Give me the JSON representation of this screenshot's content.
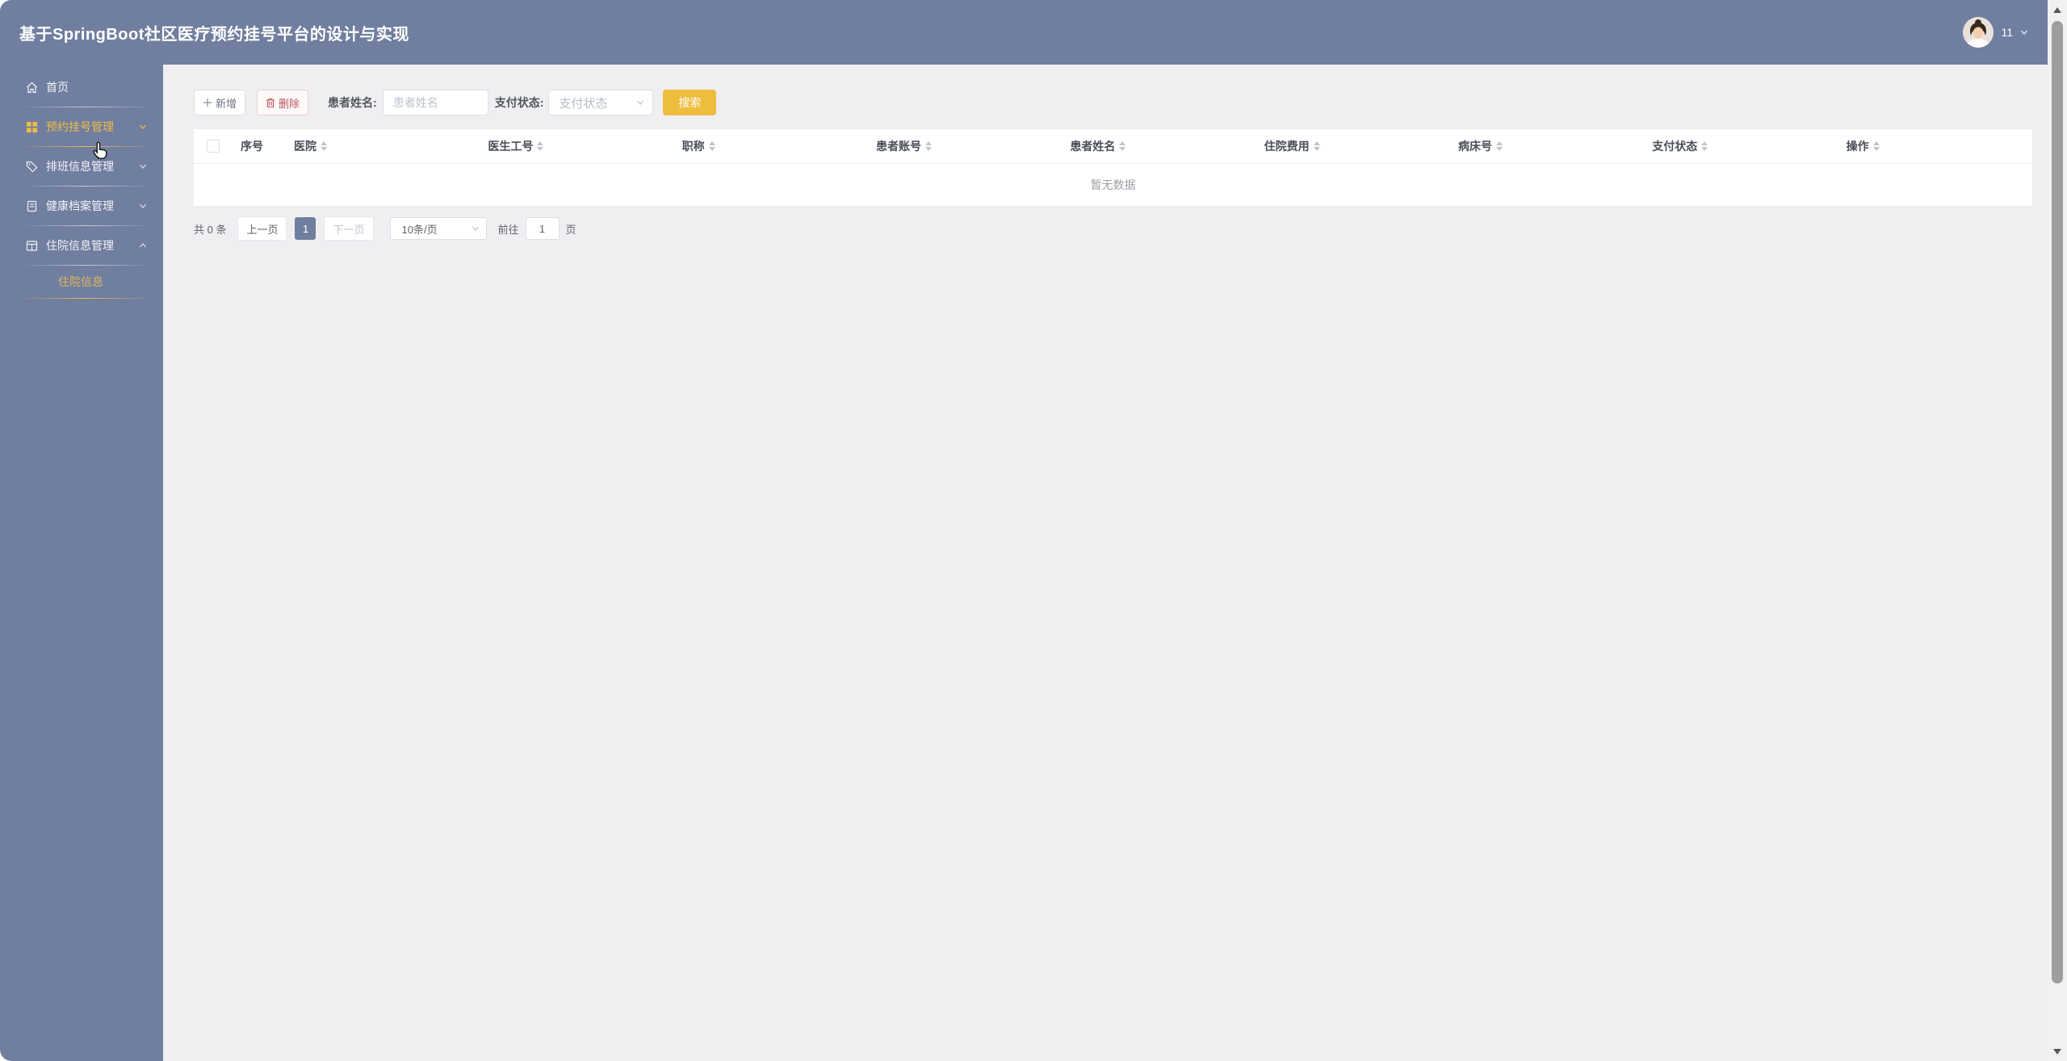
{
  "header": {
    "title": "基于SpringBoot社区医疗预约挂号平台的设计与实现",
    "username": "11"
  },
  "sidebar": {
    "items": [
      {
        "label": "首页",
        "icon": "home-icon",
        "state": "normal"
      },
      {
        "label": "预约挂号管理",
        "icon": "appointment-grid-icon",
        "state": "hovered",
        "chevron": "down"
      },
      {
        "label": "排班信息管理",
        "icon": "schedule-tag-icon",
        "state": "normal",
        "chevron": "down"
      },
      {
        "label": "健康档案管理",
        "icon": "health-record-icon",
        "state": "normal",
        "chevron": "down"
      },
      {
        "label": "住院信息管理",
        "icon": "hospitalization-table-icon",
        "state": "expanded",
        "chevron": "up"
      },
      {
        "label": "住院信息",
        "submenu": true,
        "state": "active"
      }
    ]
  },
  "toolbar": {
    "add_label": "新增",
    "delete_label": "删除",
    "patient_name_label": "患者姓名:",
    "patient_name_placeholder": "患者姓名",
    "pay_status_label": "支付状态:",
    "pay_status_placeholder": "支付状态",
    "search_label": "搜索"
  },
  "table": {
    "columns": [
      {
        "label": "序号",
        "sortable": false
      },
      {
        "label": "医院",
        "sortable": true
      },
      {
        "label": "医生工号",
        "sortable": true
      },
      {
        "label": "职称",
        "sortable": true
      },
      {
        "label": "患者账号",
        "sortable": true
      },
      {
        "label": "患者姓名",
        "sortable": true
      },
      {
        "label": "住院费用",
        "sortable": true
      },
      {
        "label": "病床号",
        "sortable": true
      },
      {
        "label": "支付状态",
        "sortable": true
      },
      {
        "label": "操作",
        "sortable": true
      }
    ],
    "rows": [],
    "empty_text": "暂无数据"
  },
  "pagination": {
    "total_text": "共 0 条",
    "prev_label": "上一页",
    "current_page": "1",
    "next_label": "下一页",
    "page_size_label": "10条/页",
    "goto_label": "前往",
    "goto_value": "1",
    "goto_suffix": "页"
  },
  "colors": {
    "primary_slate": "#707e9f",
    "accent_gold": "#eebd3e",
    "sidebar_hover_gold": "#f0bc45",
    "submenu_gold": "#e2b55c",
    "danger_red": "#bb5360",
    "main_bg": "#efeff1"
  },
  "icons": [
    "home-icon",
    "appointment-grid-icon",
    "schedule-tag-icon",
    "health-record-icon",
    "hospitalization-table-icon",
    "chevron-down-icon",
    "chevron-up-icon",
    "plus-icon",
    "trash-icon",
    "sort-carets",
    "checkbox",
    "avatar",
    "hand-cursor",
    "scroll-up-arrow",
    "scroll-down-arrow"
  ]
}
